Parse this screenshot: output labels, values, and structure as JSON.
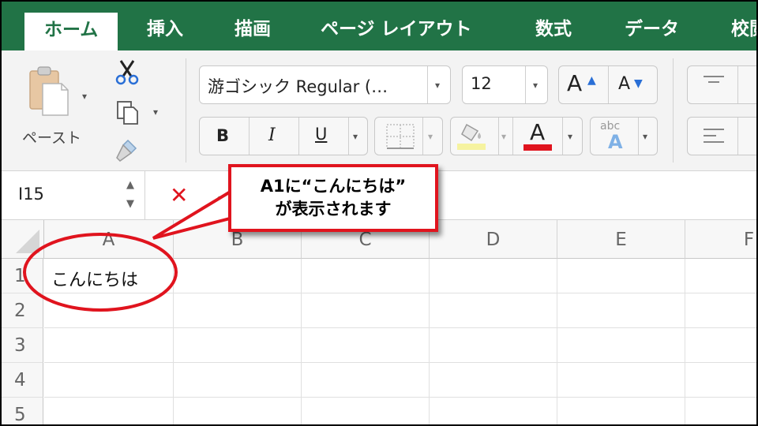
{
  "tabs": [
    {
      "label": "ホーム",
      "active": true
    },
    {
      "label": "挿入"
    },
    {
      "label": "描画"
    },
    {
      "label": "ページ レイアウト"
    },
    {
      "label": "数式"
    },
    {
      "label": "データ"
    },
    {
      "label": "校閲"
    }
  ],
  "clipboard": {
    "paste_label": "ペースト",
    "paste_icon": "clipboard-icon",
    "cut_icon": "scissors-icon",
    "copy_icon": "copy-icon",
    "format_painter_icon": "paintbrush-icon"
  },
  "font": {
    "name": "游ゴシック Regular (…",
    "size": "12",
    "grow_label": "A",
    "shrink_label": "A",
    "bold_label": "B",
    "italic_label": "I",
    "underline_label": "U",
    "font_color_label": "A",
    "phonetic_small_label": "abc",
    "phonetic_big_label": "A",
    "font_color_bar": "#e0141e",
    "fill_color_bar": "#f6f3a0"
  },
  "formula_bar": {
    "name_box": "I15",
    "cancel_glyph": "✕"
  },
  "grid": {
    "columns": [
      "A",
      "B",
      "C",
      "D",
      "E",
      "F"
    ],
    "rows": [
      "1",
      "2",
      "3",
      "4",
      "5"
    ],
    "cells": {
      "A1": "こんにちは"
    }
  },
  "callout": {
    "line1": "A1に“こんにちは”",
    "line2": "が表示されます"
  },
  "colors": {
    "brand": "#217346",
    "highlight": "#e0141e"
  }
}
